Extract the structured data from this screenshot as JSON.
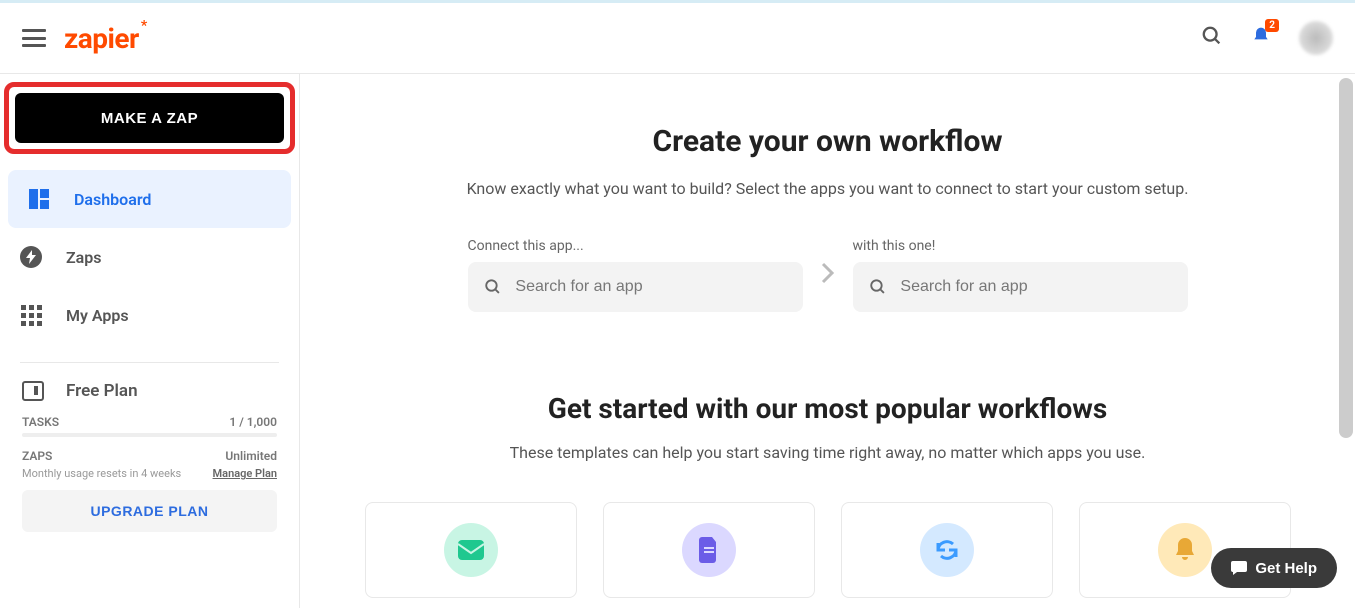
{
  "header": {
    "logo_text": "zapier",
    "notification_count": "2"
  },
  "sidebar": {
    "make_zap_label": "MAKE A ZAP",
    "items": [
      {
        "label": "Dashboard"
      },
      {
        "label": "Zaps"
      },
      {
        "label": "My Apps"
      }
    ],
    "plan": {
      "name": "Free Plan",
      "tasks_label": "TASKS",
      "tasks_value": "1 / 1,000",
      "zaps_label": "ZAPS",
      "zaps_value": "Unlimited",
      "reset_text": "Monthly usage resets in 4 weeks",
      "manage_label": "Manage Plan",
      "upgrade_label": "UPGRADE PLAN"
    }
  },
  "main": {
    "hero_title": "Create your own workflow",
    "hero_sub": "Know exactly what you want to build? Select the apps you want to connect to start your custom setup.",
    "connect_label_left": "Connect this app...",
    "connect_label_right": "with this one!",
    "search_placeholder": "Search for an app",
    "popular_title": "Get started with our most popular workflows",
    "popular_sub": "These templates can help you start saving time right away, no matter which apps you use."
  },
  "help_button": "Get Help"
}
